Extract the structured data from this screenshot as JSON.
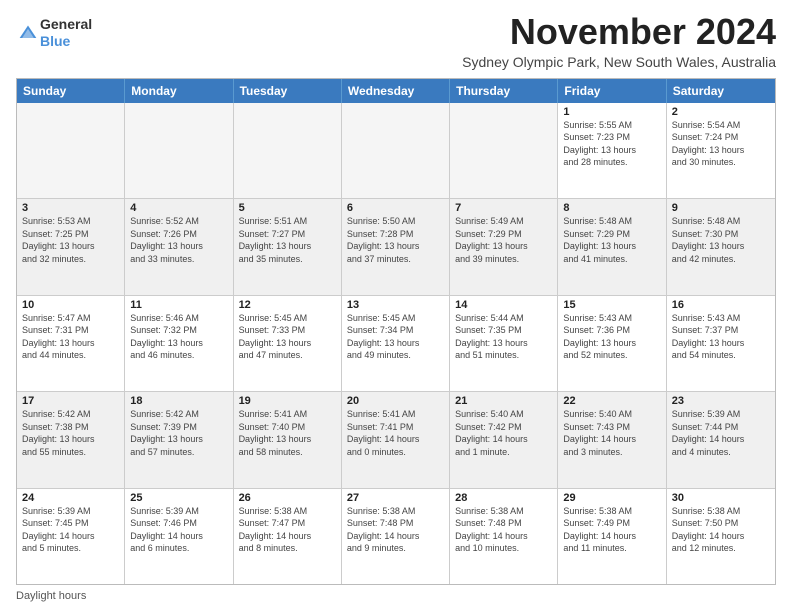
{
  "logo": {
    "general": "General",
    "blue": "Blue"
  },
  "title": "November 2024",
  "subtitle": "Sydney Olympic Park, New South Wales, Australia",
  "header_days": [
    "Sunday",
    "Monday",
    "Tuesday",
    "Wednesday",
    "Thursday",
    "Friday",
    "Saturday"
  ],
  "rows": [
    [
      {
        "day": "",
        "info": "",
        "empty": true
      },
      {
        "day": "",
        "info": "",
        "empty": true
      },
      {
        "day": "",
        "info": "",
        "empty": true
      },
      {
        "day": "",
        "info": "",
        "empty": true
      },
      {
        "day": "",
        "info": "",
        "empty": true
      },
      {
        "day": "1",
        "info": "Sunrise: 5:55 AM\nSunset: 7:23 PM\nDaylight: 13 hours\nand 28 minutes."
      },
      {
        "day": "2",
        "info": "Sunrise: 5:54 AM\nSunset: 7:24 PM\nDaylight: 13 hours\nand 30 minutes."
      }
    ],
    [
      {
        "day": "3",
        "info": "Sunrise: 5:53 AM\nSunset: 7:25 PM\nDaylight: 13 hours\nand 32 minutes."
      },
      {
        "day": "4",
        "info": "Sunrise: 5:52 AM\nSunset: 7:26 PM\nDaylight: 13 hours\nand 33 minutes."
      },
      {
        "day": "5",
        "info": "Sunrise: 5:51 AM\nSunset: 7:27 PM\nDaylight: 13 hours\nand 35 minutes."
      },
      {
        "day": "6",
        "info": "Sunrise: 5:50 AM\nSunset: 7:28 PM\nDaylight: 13 hours\nand 37 minutes."
      },
      {
        "day": "7",
        "info": "Sunrise: 5:49 AM\nSunset: 7:29 PM\nDaylight: 13 hours\nand 39 minutes."
      },
      {
        "day": "8",
        "info": "Sunrise: 5:48 AM\nSunset: 7:29 PM\nDaylight: 13 hours\nand 41 minutes."
      },
      {
        "day": "9",
        "info": "Sunrise: 5:48 AM\nSunset: 7:30 PM\nDaylight: 13 hours\nand 42 minutes."
      }
    ],
    [
      {
        "day": "10",
        "info": "Sunrise: 5:47 AM\nSunset: 7:31 PM\nDaylight: 13 hours\nand 44 minutes."
      },
      {
        "day": "11",
        "info": "Sunrise: 5:46 AM\nSunset: 7:32 PM\nDaylight: 13 hours\nand 46 minutes."
      },
      {
        "day": "12",
        "info": "Sunrise: 5:45 AM\nSunset: 7:33 PM\nDaylight: 13 hours\nand 47 minutes."
      },
      {
        "day": "13",
        "info": "Sunrise: 5:45 AM\nSunset: 7:34 PM\nDaylight: 13 hours\nand 49 minutes."
      },
      {
        "day": "14",
        "info": "Sunrise: 5:44 AM\nSunset: 7:35 PM\nDaylight: 13 hours\nand 51 minutes."
      },
      {
        "day": "15",
        "info": "Sunrise: 5:43 AM\nSunset: 7:36 PM\nDaylight: 13 hours\nand 52 minutes."
      },
      {
        "day": "16",
        "info": "Sunrise: 5:43 AM\nSunset: 7:37 PM\nDaylight: 13 hours\nand 54 minutes."
      }
    ],
    [
      {
        "day": "17",
        "info": "Sunrise: 5:42 AM\nSunset: 7:38 PM\nDaylight: 13 hours\nand 55 minutes."
      },
      {
        "day": "18",
        "info": "Sunrise: 5:42 AM\nSunset: 7:39 PM\nDaylight: 13 hours\nand 57 minutes."
      },
      {
        "day": "19",
        "info": "Sunrise: 5:41 AM\nSunset: 7:40 PM\nDaylight: 13 hours\nand 58 minutes."
      },
      {
        "day": "20",
        "info": "Sunrise: 5:41 AM\nSunset: 7:41 PM\nDaylight: 14 hours\nand 0 minutes."
      },
      {
        "day": "21",
        "info": "Sunrise: 5:40 AM\nSunset: 7:42 PM\nDaylight: 14 hours\nand 1 minute."
      },
      {
        "day": "22",
        "info": "Sunrise: 5:40 AM\nSunset: 7:43 PM\nDaylight: 14 hours\nand 3 minutes."
      },
      {
        "day": "23",
        "info": "Sunrise: 5:39 AM\nSunset: 7:44 PM\nDaylight: 14 hours\nand 4 minutes."
      }
    ],
    [
      {
        "day": "24",
        "info": "Sunrise: 5:39 AM\nSunset: 7:45 PM\nDaylight: 14 hours\nand 5 minutes."
      },
      {
        "day": "25",
        "info": "Sunrise: 5:39 AM\nSunset: 7:46 PM\nDaylight: 14 hours\nand 6 minutes."
      },
      {
        "day": "26",
        "info": "Sunrise: 5:38 AM\nSunset: 7:47 PM\nDaylight: 14 hours\nand 8 minutes."
      },
      {
        "day": "27",
        "info": "Sunrise: 5:38 AM\nSunset: 7:48 PM\nDaylight: 14 hours\nand 9 minutes."
      },
      {
        "day": "28",
        "info": "Sunrise: 5:38 AM\nSunset: 7:48 PM\nDaylight: 14 hours\nand 10 minutes."
      },
      {
        "day": "29",
        "info": "Sunrise: 5:38 AM\nSunset: 7:49 PM\nDaylight: 14 hours\nand 11 minutes."
      },
      {
        "day": "30",
        "info": "Sunrise: 5:38 AM\nSunset: 7:50 PM\nDaylight: 14 hours\nand 12 minutes."
      }
    ]
  ],
  "footer": "Daylight hours"
}
